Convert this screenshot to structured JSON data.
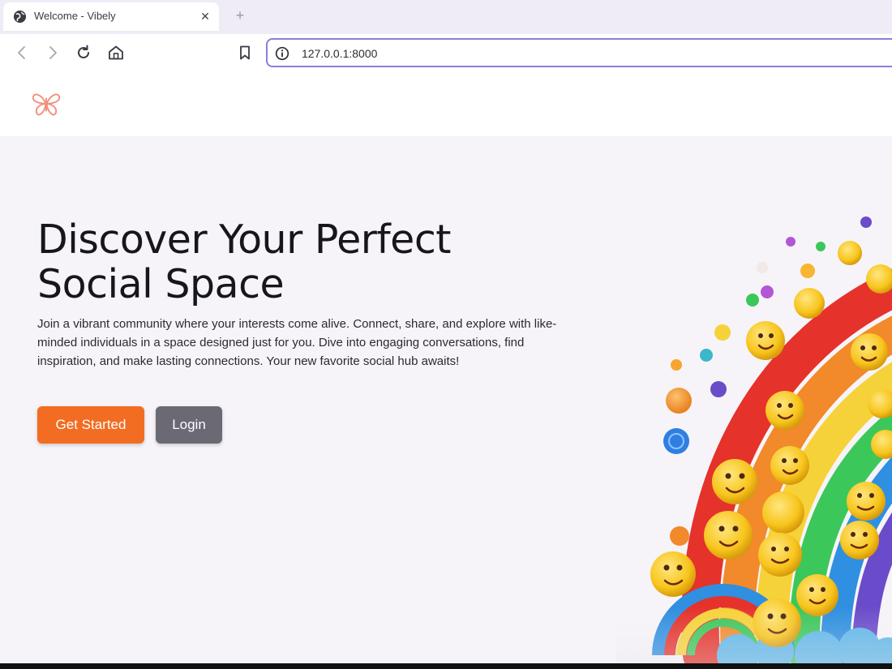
{
  "browser": {
    "tab": {
      "title": "Welcome - Vibely",
      "favicon": "globe-icon",
      "close_glyph": "✕"
    },
    "new_tab_glyph": "+",
    "toolbar": {
      "back_icon": "back-arrow-icon",
      "forward_icon": "forward-arrow-icon",
      "reload_icon": "reload-icon",
      "home_icon": "home-icon",
      "bookmark_icon": "bookmark-icon"
    },
    "address": {
      "info_icon": "info-icon",
      "url": "127.0.0.1:8000",
      "focus_color": "#8b7fd6"
    }
  },
  "header": {
    "logo": "butterfly-logo"
  },
  "hero": {
    "headline_line1": "Discover Your Perfect",
    "headline_line2": "Social Space",
    "description": "Join a vibrant community where your interests come alive. Connect, share, and explore with like-minded individuals in a space designed just for you. Dive into engaging conversations, find inspiration, and make lasting connections. Your new favorite social hub awaits!",
    "primary_button": "Get Started",
    "secondary_button": "Login",
    "illustration": "rainbow-emoji-illustration"
  },
  "colors": {
    "accent": "#f26c22",
    "secondary_button": "#6b6a74",
    "page_background": "#f6f4f8",
    "logo": "#f0907a"
  }
}
